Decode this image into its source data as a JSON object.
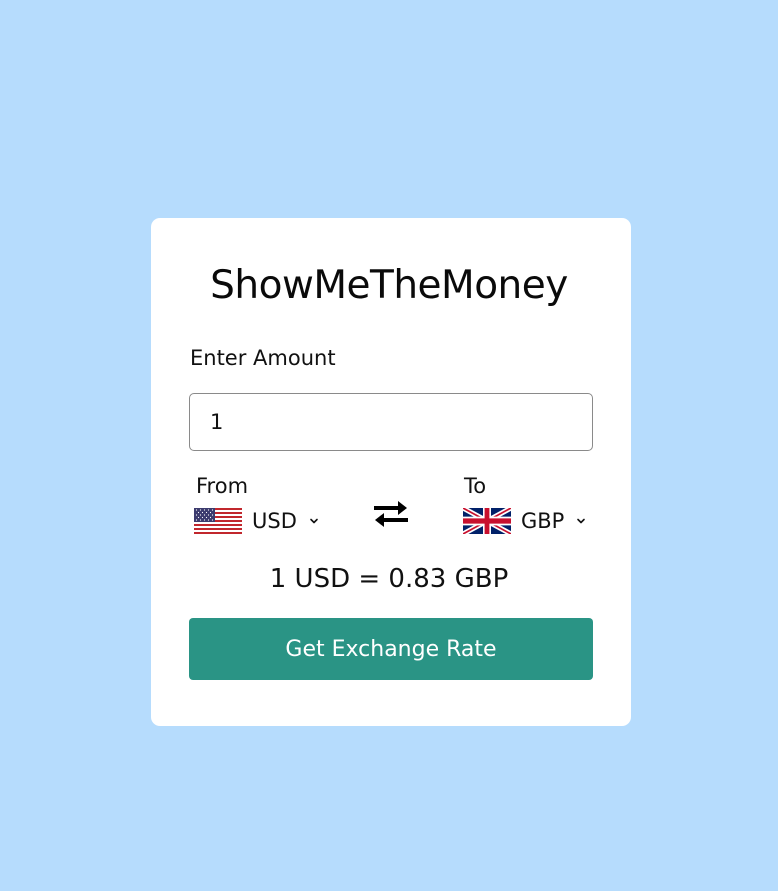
{
  "app": {
    "title": "ShowMeTheMoney"
  },
  "amount": {
    "label": "Enter Amount",
    "value": "1"
  },
  "from": {
    "label": "From",
    "currency": "USD",
    "flag_icon": "us-flag-icon"
  },
  "to": {
    "label": "To",
    "currency": "GBP",
    "flag_icon": "uk-flag-icon"
  },
  "swap_icon": "swap-arrows-icon",
  "result": {
    "text": "1 USD = 0.83 GBP"
  },
  "button": {
    "label": "Get Exchange Rate"
  },
  "colors": {
    "background": "#b6dcfd",
    "card": "#ffffff",
    "button": "#2a9485"
  }
}
